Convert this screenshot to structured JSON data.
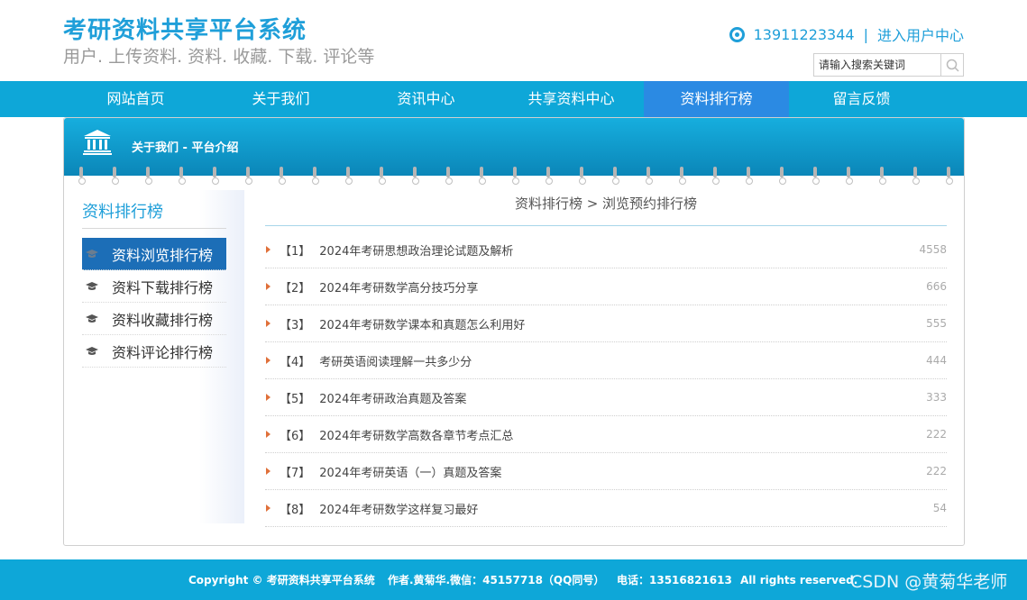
{
  "header": {
    "site_title": "考研资料共享平台系统",
    "site_subtitle": "用户. 上传资料. 资料. 收藏. 下载. 评论等",
    "phone": "13911223344",
    "separator": "|",
    "user_center_link": "进入用户中心",
    "search_placeholder": "请输入搜索关键词"
  },
  "nav": [
    {
      "label": "网站首页",
      "active": false
    },
    {
      "label": "关于我们",
      "active": false
    },
    {
      "label": "资讯中心",
      "active": false
    },
    {
      "label": "共享资料中心",
      "active": false
    },
    {
      "label": "资料排行榜",
      "active": true
    },
    {
      "label": "留言反馈",
      "active": false
    }
  ],
  "banner": {
    "label": "关于我们 - 平台介绍"
  },
  "sidebar": {
    "title": "资料排行榜",
    "items": [
      {
        "label": "资料浏览排行榜",
        "active": true
      },
      {
        "label": "资料下载排行榜",
        "active": false
      },
      {
        "label": "资料收藏排行榜",
        "active": false
      },
      {
        "label": "资料评论排行榜",
        "active": false
      }
    ]
  },
  "main": {
    "breadcrumb": "资料排行榜 > 浏览预约排行榜",
    "rows": [
      {
        "index": "【1】",
        "title": "2024年考研思想政治理论试题及解析",
        "count": "4558"
      },
      {
        "index": "【2】",
        "title": "2024年考研数学高分技巧分享",
        "count": "666"
      },
      {
        "index": "【3】",
        "title": "2024年考研数学课本和真题怎么利用好",
        "count": "555"
      },
      {
        "index": "【4】",
        "title": "考研英语阅读理解一共多少分",
        "count": "444"
      },
      {
        "index": "【5】",
        "title": "2024年考研政治真题及答案",
        "count": "333"
      },
      {
        "index": "【6】",
        "title": "2024年考研数学高数各章节考点汇总",
        "count": "222"
      },
      {
        "index": "【7】",
        "title": "2024年考研英语（一）真题及答案",
        "count": "222"
      },
      {
        "index": "【8】",
        "title": "2024年考研数学这样复习最好",
        "count": "54"
      }
    ]
  },
  "footer": {
    "copyright": "Copyright © 考研资料共享平台系统",
    "author": "作者.黄菊华.微信：45157718（QQ同号）",
    "phone": "电话：13516821613",
    "rights": "All rights reserved.",
    "watermark": "CSDN @黄菊华老师"
  },
  "colors": {
    "brand_blue": "#0ea7d8",
    "nav_active": "#2b8ae3",
    "sidebar_active": "#1c6eb7",
    "arrow": "#e0703a"
  }
}
